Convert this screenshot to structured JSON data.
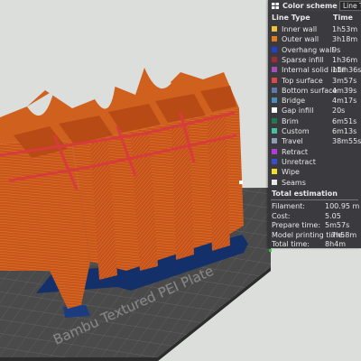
{
  "viewport": {
    "plate_label": "Bambu Textured PEI Plate"
  },
  "legend": {
    "title": "Color scheme",
    "dropdown_value": "Line Type",
    "col_type": "Line Type",
    "col_time": "Time",
    "items": [
      {
        "label": "Inner wall",
        "time": "1h53m",
        "color": "#f0c33a"
      },
      {
        "label": "Outer wall",
        "time": "3h18m",
        "color": "#e67c22"
      },
      {
        "label": "Overhang wall",
        "time": "9s",
        "color": "#2040d0"
      },
      {
        "label": "Sparse infill",
        "time": "1h36m",
        "color": "#9d2c3c"
      },
      {
        "label": "Internal solid infill",
        "time": "11m36s",
        "color": "#a64fb8"
      },
      {
        "label": "Top surface",
        "time": "3m57s",
        "color": "#e04848"
      },
      {
        "label": "Bottom surface",
        "time": "4m39s",
        "color": "#5f79a8"
      },
      {
        "label": "Bridge",
        "time": "4m17s",
        "color": "#4a8fbd"
      },
      {
        "label": "Gap infill",
        "time": "20s",
        "color": "#ffffff"
      },
      {
        "label": "Brim",
        "time": "6m51s",
        "color": "#1f7a52"
      },
      {
        "label": "Custom",
        "time": "6m13s",
        "color": "#4ac0a2"
      },
      {
        "label": "Travel",
        "time": "38m55s",
        "color": "#8aa0b8"
      },
      {
        "label": "Retract",
        "time": "",
        "color": "#b43cdc"
      },
      {
        "label": "Unretract",
        "time": "",
        "color": "#3c4cd2"
      },
      {
        "label": "Wipe",
        "time": "",
        "color": "#f0e028"
      },
      {
        "label": "Seams",
        "time": "",
        "color": "#e8e8e8"
      }
    ]
  },
  "estimation": {
    "title": "Total estimation",
    "rows": [
      {
        "label": "Filament:",
        "value": "100.95 m"
      },
      {
        "label": "Cost:",
        "value": "5.05"
      },
      {
        "label": "Prepare time:",
        "value": "5m57s"
      },
      {
        "label": "Model printing time:",
        "value": "7h58m"
      },
      {
        "label": "Total time:",
        "value": "8h4m"
      }
    ]
  }
}
